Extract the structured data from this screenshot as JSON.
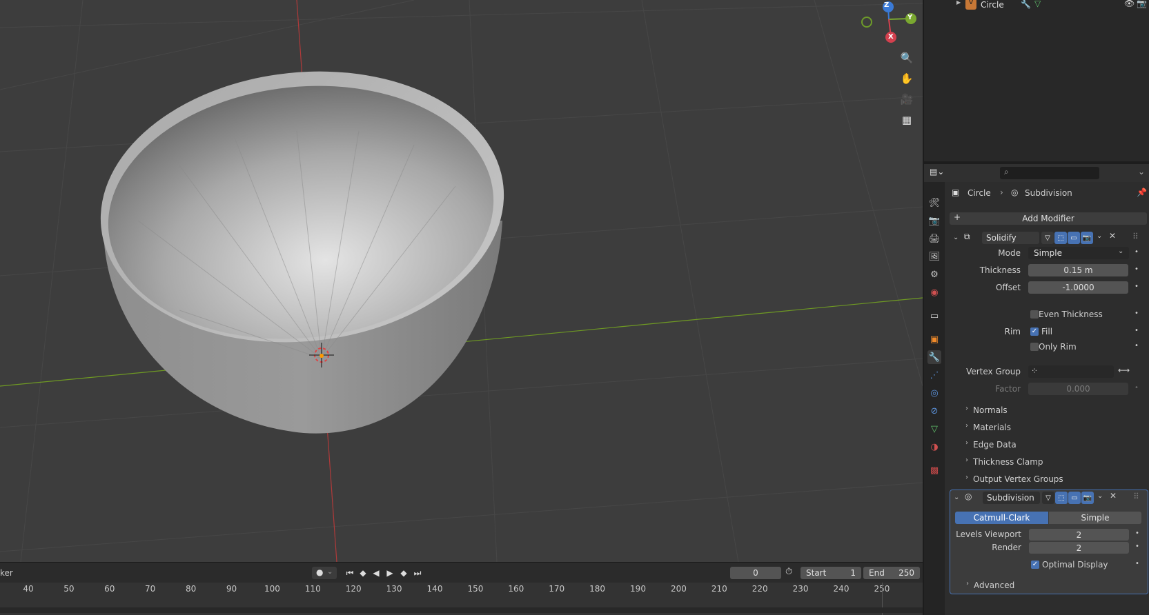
{
  "outliner": {
    "object_name": "Circle"
  },
  "gizmo": {
    "z": "Z",
    "y": "Y",
    "x": "X"
  },
  "timeline": {
    "header_left": "ker",
    "current_frame": "0",
    "start_label": "Start",
    "start_value": "1",
    "end_label": "End",
    "end_value": "250",
    "ticks": [
      "40",
      "50",
      "60",
      "70",
      "80",
      "90",
      "100",
      "110",
      "120",
      "130",
      "140",
      "150",
      "160",
      "170",
      "180",
      "190",
      "200",
      "210",
      "220",
      "230",
      "240",
      "250"
    ]
  },
  "properties": {
    "breadcrumb_object": "Circle",
    "breadcrumb_modifier": "Subdivision",
    "add_modifier": "Add Modifier",
    "solidify": {
      "name": "Solidify",
      "mode_label": "Mode",
      "mode_value": "Simple",
      "thickness_label": "Thickness",
      "thickness_value": "0.15 m",
      "offset_label": "Offset",
      "offset_value": "-1.0000",
      "even_thickness": "Even Thickness",
      "rim_label": "Rim",
      "fill": "Fill",
      "only_rim": "Only Rim",
      "vertex_group_label": "Vertex Group",
      "factor_label": "Factor",
      "factor_value": "0.000",
      "sections": [
        "Normals",
        "Materials",
        "Edge Data",
        "Thickness Clamp",
        "Output Vertex Groups"
      ]
    },
    "subdivision": {
      "name": "Subdivision",
      "tab_catmull": "Catmull-Clark",
      "tab_simple": "Simple",
      "levels_viewport_label": "Levels Viewport",
      "levels_viewport_value": "2",
      "render_label": "Render",
      "render_value": "2",
      "optimal_display": "Optimal Display",
      "advanced": "Advanced"
    }
  }
}
